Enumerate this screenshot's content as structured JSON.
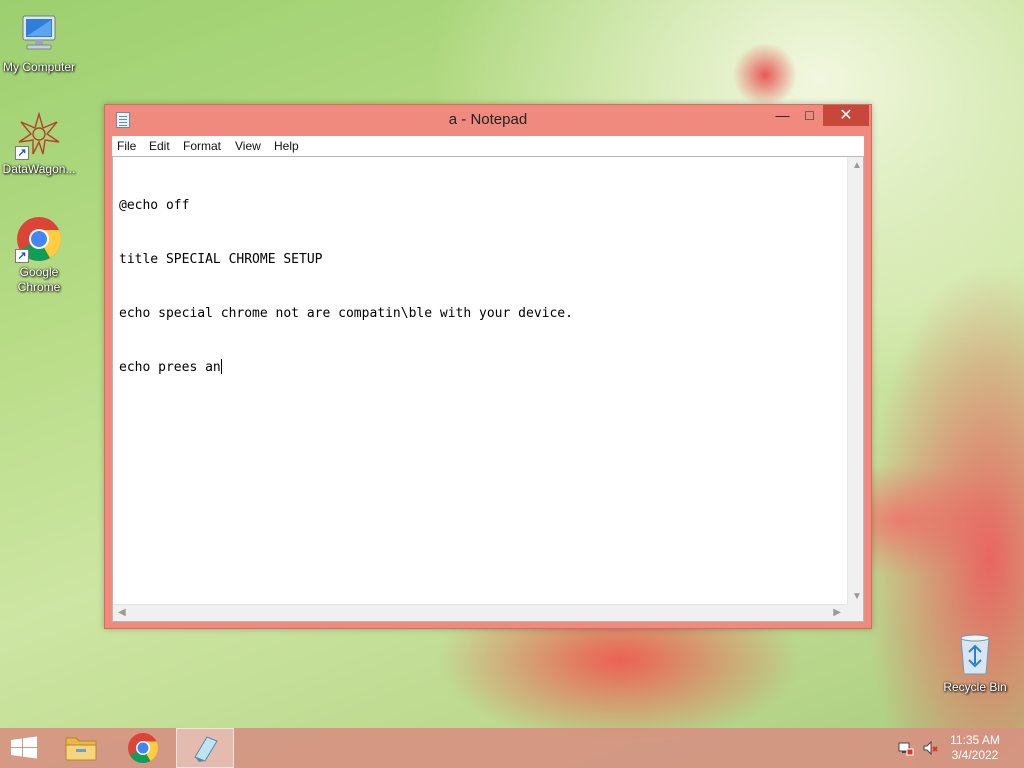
{
  "desktop": {
    "icons": [
      {
        "label": "My Computer",
        "icon": "computer-icon"
      },
      {
        "label": "DataWagon...",
        "icon": "datawagon-icon"
      },
      {
        "label": "Google Chrome",
        "icon": "chrome-icon"
      },
      {
        "label": "Recycle Bin",
        "icon": "recycle-bin-icon"
      }
    ]
  },
  "window": {
    "title": "a - Notepad",
    "icon": "notepad-icon",
    "controls": {
      "minimize": "—",
      "maximize": "□",
      "close": "✕"
    },
    "menu": [
      "File",
      "Edit",
      "Format",
      "View",
      "Help"
    ],
    "content_lines": [
      "@echo off",
      "title SPECIAL CHROME SETUP",
      "echo special chrome not are compatin\\ble with your device.",
      "echo prees an"
    ]
  },
  "taskbar": {
    "items": [
      {
        "name": "start-button",
        "icon": "windows-logo-icon"
      },
      {
        "name": "file-explorer",
        "icon": "folder-icon"
      },
      {
        "name": "chrome",
        "icon": "chrome-icon"
      },
      {
        "name": "notepad",
        "icon": "notepad-icon",
        "active": true
      }
    ],
    "tray": {
      "network_icon": "network-icon",
      "volume_icon": "volume-muted-icon"
    },
    "clock": {
      "time": "11:35 AM",
      "date": "3/4/2022"
    }
  },
  "colors": {
    "window_frame": "#f08a7e",
    "close_button": "#c7473a",
    "taskbar": "#d69282"
  }
}
